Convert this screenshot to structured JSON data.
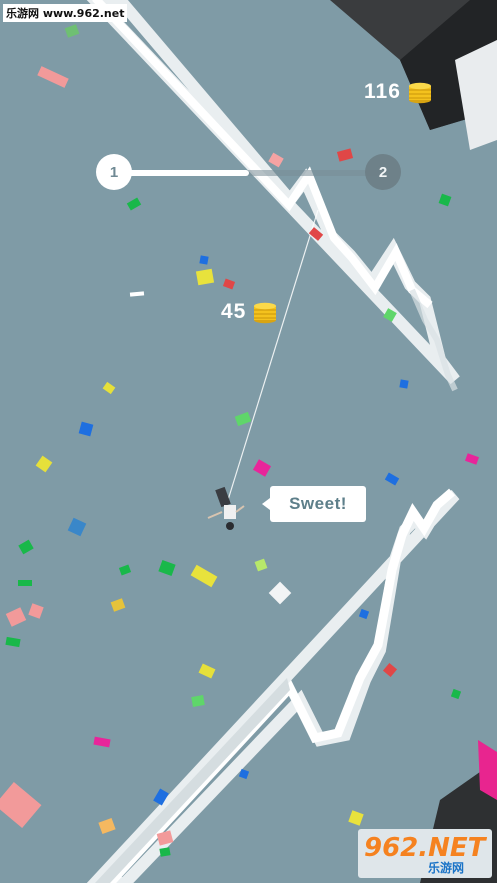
{
  "watermark_top": "乐游网 www.962.net",
  "coins_total": "116",
  "coins_earned": "45",
  "level": {
    "current": "1",
    "next": "2",
    "progress": 0.5
  },
  "speech_bubble": "Sweet!",
  "watermark_bottom": {
    "brand": "962.NET",
    "sub": "乐游网"
  },
  "colors": {
    "background": "#7f9ba6",
    "track": "#f4f6f7",
    "coin": "#f4c21d",
    "accent_magenta": "#e8259a"
  }
}
